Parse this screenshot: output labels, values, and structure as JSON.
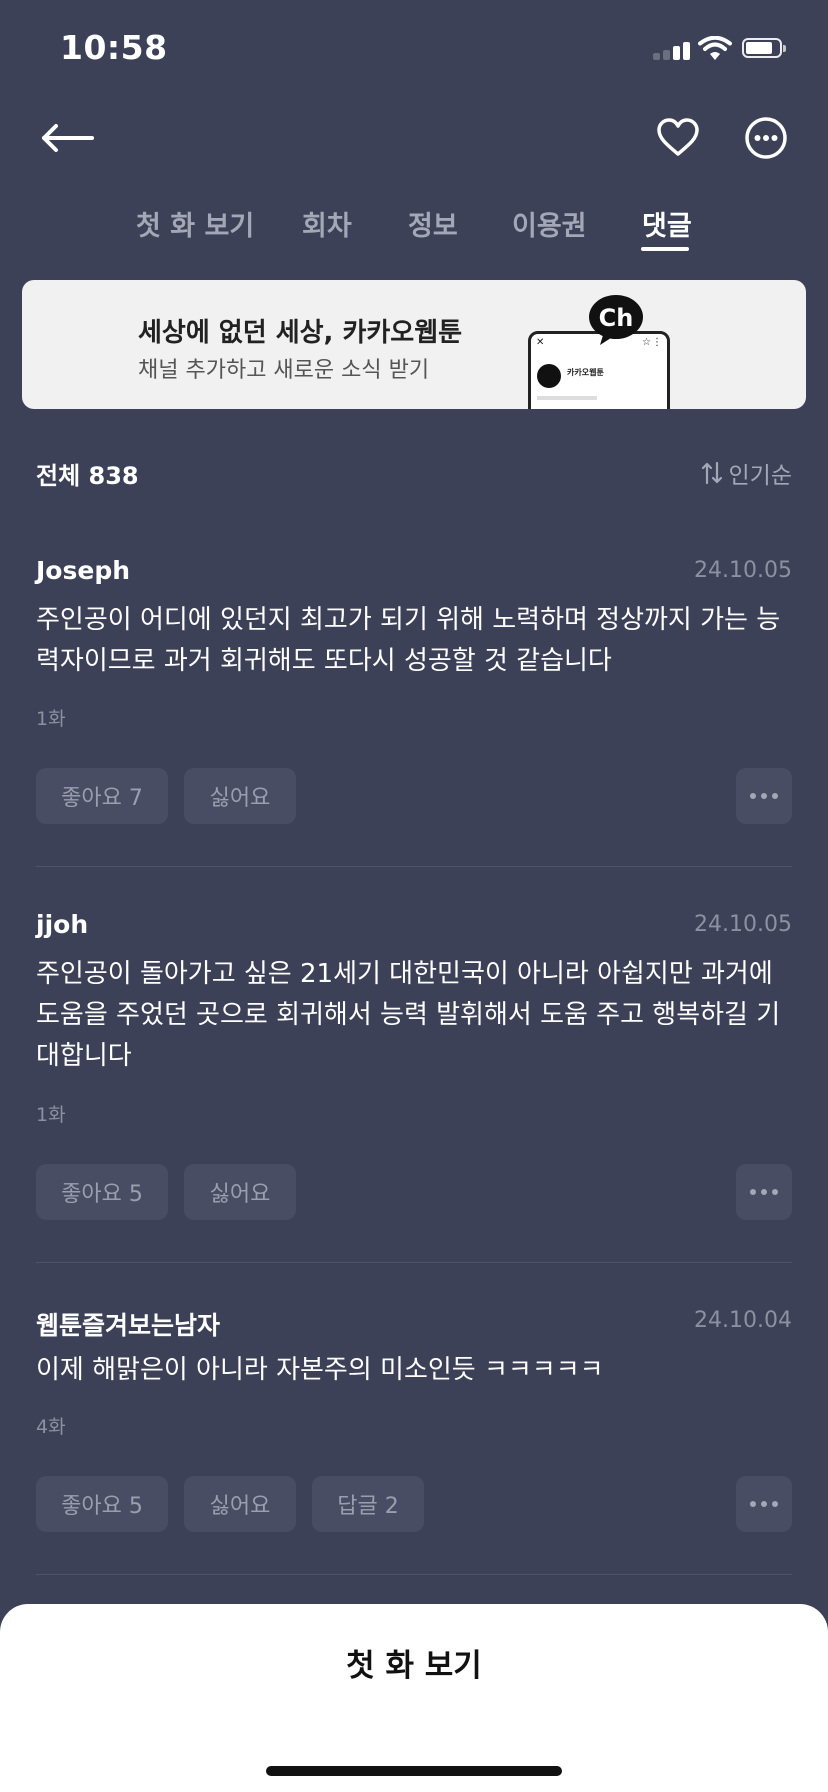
{
  "status_bar": {
    "time": "10:58"
  },
  "nav": {
    "back_icon": "arrow-left-icon",
    "heart_icon": "heart-icon",
    "more_icon": "more-circle-icon"
  },
  "tabs": [
    {
      "label": "첫 화 보기",
      "active": false
    },
    {
      "label": "회차",
      "active": false
    },
    {
      "label": "정보",
      "active": false
    },
    {
      "label": "이용권",
      "active": false
    },
    {
      "label": "댓글",
      "active": true
    }
  ],
  "banner": {
    "title": "세상에 없던 세상, 카카오웹툰",
    "subtitle": "채널 추가하고 새로운 소식 받기",
    "badge": "Ch",
    "phone_name": "카카오웹툰"
  },
  "list_header": {
    "total": "전체 838",
    "sort": "인기순"
  },
  "comments": [
    {
      "author": "Joseph",
      "date": "24.10.05",
      "body": "주인공이 어디에 있던지 최고가 되기 위해 노력하며 정상까지 가는 능력자이므로 과거 회귀해도 또다시 성공할 것 같습니다",
      "episode": "1화",
      "like": "좋아요 7",
      "dislike": "싫어요"
    },
    {
      "author": "jjoh",
      "date": "24.10.05",
      "body": "주인공이 돌아가고 싶은 21세기 대한민국이 아니라 아쉽지만 과거에 도움을 주었던 곳으로 회귀해서 능력 발휘해서 도움 주고 행복하길 기대합니다",
      "episode": "1화",
      "like": "좋아요 5",
      "dislike": "싫어요"
    },
    {
      "author": "웹툰즐겨보는남자",
      "date": "24.10.04",
      "body": "이제 해맑은이 아니라 자본주의 미소인듯 ㅋㅋㅋㅋㅋ",
      "episode": "4화",
      "like": "좋아요 5",
      "dislike": "싫어요",
      "reply": "답글 2"
    }
  ],
  "bottom_sheet": {
    "button": "첫 화 보기"
  }
}
